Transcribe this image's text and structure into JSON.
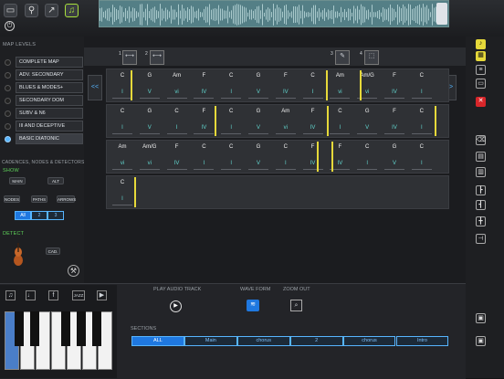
{
  "topbar": {
    "icons": [
      "folder-icon",
      "pin-icon",
      "share-icon",
      "music-note-icon",
      "power-icon"
    ]
  },
  "left": {
    "map_levels_title": "MAP LEVELS",
    "levels": [
      {
        "label": "COMPLETE MAP",
        "active": false
      },
      {
        "label": "ADV. SECONDARY",
        "active": false
      },
      {
        "label": "BLUES & MODES+",
        "active": false
      },
      {
        "label": "SECONDARY DOM",
        "active": false
      },
      {
        "label": "SUBV & N6",
        "active": false
      },
      {
        "label": "III AND DECEPTIVE",
        "active": false
      },
      {
        "label": "BASIC DIATONIC",
        "active": true
      }
    ],
    "cadences_title": "CADENCES, NODES & DETECTORS",
    "show_label": "SHOW",
    "main_label": "MAIN",
    "alt_label": "ALT",
    "nodes_label": "NODES",
    "paths_label": "PATHS",
    "arrows_label": "ARROWS",
    "segment": [
      "All",
      "2",
      "3"
    ],
    "detect_label": "DETECT",
    "cad_label": "CAD."
  },
  "grid": {
    "section_markers": [
      "1",
      "2",
      "3",
      "4"
    ],
    "nav_prev": "<<",
    "nav_next": ">>",
    "rows": [
      {
        "beats": [
          [
            "C",
            "I"
          ],
          [
            "G",
            "V"
          ],
          [
            "Am",
            "vi"
          ],
          [
            "F",
            "IV"
          ],
          [
            "C",
            "I"
          ],
          [
            "G",
            "V"
          ],
          [
            "F",
            "IV"
          ],
          [
            "C",
            "I"
          ],
          [
            "Am",
            "vi"
          ],
          [
            "Am/G",
            "vi"
          ],
          [
            "F",
            "IV"
          ],
          [
            "C",
            "I"
          ]
        ]
      },
      {
        "beats": [
          [
            "C",
            "I"
          ],
          [
            "G",
            "V"
          ],
          [
            "C",
            "I"
          ],
          [
            "F",
            "IV"
          ],
          [
            "C",
            "I"
          ],
          [
            "G",
            "V"
          ],
          [
            "Am",
            "vi"
          ],
          [
            "F",
            "IV"
          ],
          [
            "C",
            "I"
          ],
          [
            "G",
            "V"
          ],
          [
            "F",
            "IV"
          ],
          [
            "C",
            "I"
          ]
        ]
      },
      {
        "beats": [
          [
            "Am",
            "vi"
          ],
          [
            "Am/G",
            "vi"
          ],
          [
            "F",
            "IV"
          ],
          [
            "C",
            "I"
          ],
          [
            "C",
            "I"
          ],
          [
            "G",
            "V"
          ],
          [
            "C",
            "I"
          ],
          [
            "F",
            "IV"
          ],
          [
            "F",
            "IV"
          ],
          [
            "C",
            "I"
          ],
          [
            "G",
            "V"
          ],
          [
            "C",
            "I"
          ]
        ]
      },
      {
        "beats": [
          [
            "C",
            "I"
          ]
        ]
      }
    ]
  },
  "bottom": {
    "play_label": "PLAY AUDIO TRACK",
    "wave_label": "WAVE FORM",
    "zoom_label": "ZOOM OUT",
    "sections_label": "SECTIONS",
    "sections": [
      "ALL",
      "Main",
      "chorus",
      "2",
      "chorus",
      "Intro"
    ],
    "selected_section": "ALL",
    "keyboard_icons": [
      "music-note-icon",
      "guitar-icon",
      "fretboard-icon",
      "jazz-icon",
      "video-icon"
    ],
    "jazz_label": "JAZZ"
  },
  "colors": {
    "accent": "#57b5ff",
    "roman": "#62d6cf",
    "barline": "#e6d93a",
    "detect": "#5fd35a"
  }
}
